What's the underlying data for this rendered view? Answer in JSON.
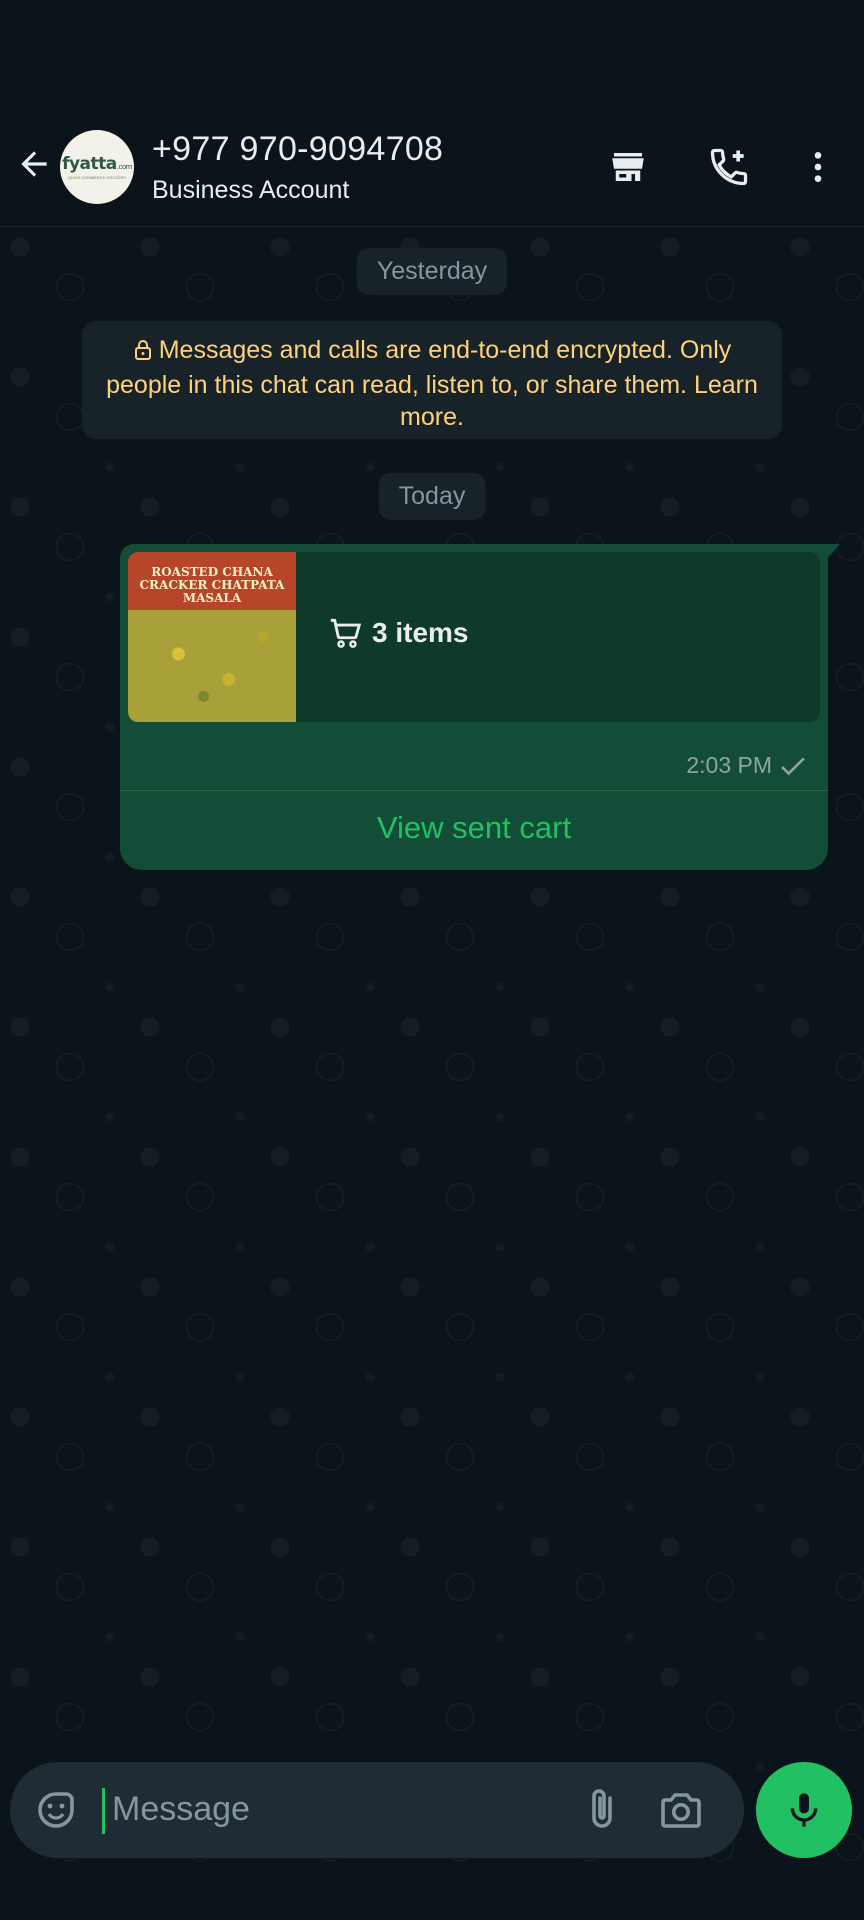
{
  "header": {
    "contact_name": "+977 970-9094708",
    "contact_subtitle": "Business Account",
    "avatar": {
      "brand": "fyatta",
      "brand_suffix": ".com",
      "tagline": "QUICK COMMERCE GROCERY"
    },
    "icons": [
      "back-arrow-icon",
      "storefront-icon",
      "add-call-icon",
      "more-vert-icon"
    ]
  },
  "chat": {
    "date_chip_1": "Yesterday",
    "encryption_notice": "Messages and calls are end-to-end encrypted. Only people in this chat can read, listen to, or share them. Learn more.",
    "date_chip_2": "Today",
    "message": {
      "product_image_text": "ROASTED CHANA CRACKER CHATPATA MASALA",
      "cart_label": "3 items",
      "time": "2:03 PM",
      "status": "sent",
      "action_label": "View sent cart"
    }
  },
  "composer": {
    "placeholder": "Message"
  },
  "colors": {
    "background": "#0b141a",
    "bubble_outgoing": "#144d37",
    "accent": "#21c063",
    "encryption_text": "#ffd279"
  }
}
